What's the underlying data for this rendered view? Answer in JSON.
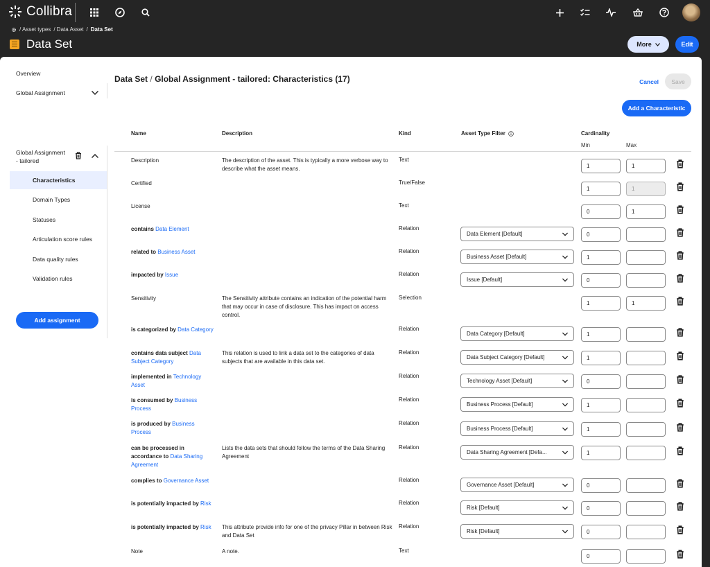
{
  "app": {
    "brand_name": "Collibra"
  },
  "breadcrumb": {
    "items": [
      "/ Asset types",
      "/ Data Asset",
      "/"
    ],
    "current": "Data Set"
  },
  "header": {
    "title": "Data Set",
    "more_label": "More",
    "edit_label": "Edit"
  },
  "sidebar": {
    "overview": "Overview",
    "global_assignment": "Global Assignment",
    "tailored_line1": "Global Assignment",
    "tailored_line2": "- tailored",
    "sub_items": [
      "Characteristics",
      "Domain Types",
      "Statuses",
      "Articulation score rules",
      "Data quality rules",
      "Validation rules"
    ],
    "active_index": 0,
    "add_assignment": "Add assignment"
  },
  "main": {
    "title_prefix": "Data Set",
    "title_slash": "/",
    "title_rest": "Global Assignment - tailored: Characteristics (17)",
    "cancel_label": "Cancel",
    "save_label": "Save",
    "add_characteristic_label": "Add a Characteristic"
  },
  "table": {
    "headers": {
      "name": "Name",
      "description": "Description",
      "kind": "Kind",
      "asset_type_filter": "Asset Type Filter",
      "cardinality": "Cardinality",
      "min": "Min",
      "max": "Max"
    },
    "rows": [
      {
        "verb": "",
        "link": "",
        "plain": "Description",
        "description": "The description of the asset. This is typically a more verbose way to describe what the asset means.",
        "kind": "Text",
        "filter": "",
        "min": "1",
        "max": "1",
        "max_disabled": false
      },
      {
        "verb": "",
        "link": "",
        "plain": "Certified",
        "description": "",
        "kind": "True/False",
        "filter": "",
        "min": "1",
        "max": "1",
        "max_disabled": true
      },
      {
        "verb": "",
        "link": "",
        "plain": "License",
        "description": "",
        "kind": "Text",
        "filter": "",
        "min": "0",
        "max": "1",
        "max_disabled": false
      },
      {
        "verb": "contains",
        "link": "Data Element",
        "plain": "",
        "description": "",
        "kind": "Relation",
        "filter": "Data Element [Default]",
        "min": "0",
        "max": "",
        "max_disabled": false
      },
      {
        "verb": "related to",
        "link": "Business Asset",
        "plain": "",
        "description": "",
        "kind": "Relation",
        "filter": "Business Asset [Default]",
        "min": "1",
        "max": "",
        "max_disabled": false
      },
      {
        "verb": "impacted by",
        "link": "Issue",
        "plain": "",
        "description": "",
        "kind": "Relation",
        "filter": "Issue [Default]",
        "min": "0",
        "max": "",
        "max_disabled": false
      },
      {
        "verb": "",
        "link": "",
        "plain": "Sensitivity",
        "description": "The Sensitivity attribute contains an indication of the potential harm that may occur in case of disclosure. This has impact on access control.",
        "kind": "Selection",
        "filter": "",
        "min": "1",
        "max": "1",
        "max_disabled": false
      },
      {
        "verb": "is categorized by",
        "link": "Data Category",
        "plain": "",
        "description": "",
        "kind": "Relation",
        "filter": "Data Category [Default]",
        "min": "1",
        "max": "",
        "max_disabled": false
      },
      {
        "verb": "contains data subject",
        "link": "Data Subject Category",
        "plain": "",
        "description": "This relation is used to link a data set to the categories of data subjects that are available in this data set.",
        "kind": "Relation",
        "filter": "Data Subject Category [Default]",
        "min": "1",
        "max": "",
        "max_disabled": false
      },
      {
        "verb": "implemented in",
        "link": "Technology Asset",
        "plain": "",
        "description": "",
        "kind": "Relation",
        "filter": "Technology Asset [Default]",
        "min": "0",
        "max": "",
        "max_disabled": false
      },
      {
        "verb": "is consumed by",
        "link": "Business Process",
        "plain": "",
        "description": "",
        "kind": "Relation",
        "filter": "Business Process [Default]",
        "min": "1",
        "max": "",
        "max_disabled": false
      },
      {
        "verb": "is produced by",
        "link": "Business Process",
        "plain": "",
        "description": "",
        "kind": "Relation",
        "filter": "Business Process [Default]",
        "min": "1",
        "max": "",
        "max_disabled": false
      },
      {
        "verb": "can be processed in accordance to",
        "link": "Data Sharing Agreement",
        "plain": "",
        "description": "Lists the data sets that should follow the terms of the Data Sharing Agreement",
        "kind": "Relation",
        "filter": "Data Sharing Agreement [Defa...",
        "min": "1",
        "max": "",
        "max_disabled": false
      },
      {
        "verb": "complies to",
        "link": "Governance Asset",
        "plain": "",
        "description": "",
        "kind": "Relation",
        "filter": "Governance Asset [Default]",
        "min": "0",
        "max": "",
        "max_disabled": false
      },
      {
        "verb": "is potentially impacted by",
        "link": "Risk",
        "plain": "",
        "description": "",
        "kind": "Relation",
        "filter": "Risk [Default]",
        "min": "0",
        "max": "",
        "max_disabled": false
      },
      {
        "verb": "is potentially impacted by",
        "link": "Risk",
        "plain": "",
        "description": "This attribute provide info for one of the privacy Pillar in between Risk and Data Set",
        "kind": "Relation",
        "filter": "Risk [Default]",
        "min": "0",
        "max": "",
        "max_disabled": false
      },
      {
        "verb": "",
        "link": "",
        "plain": "Note",
        "description": "A note.",
        "kind": "Text",
        "filter": "",
        "min": "0",
        "max": "",
        "max_disabled": false
      }
    ]
  },
  "icons": {
    "topbar": [
      "apps-grid-icon",
      "compass-icon",
      "search-icon",
      "plus-icon",
      "task-list-icon",
      "activity-icon",
      "basket-icon",
      "help-icon"
    ]
  }
}
